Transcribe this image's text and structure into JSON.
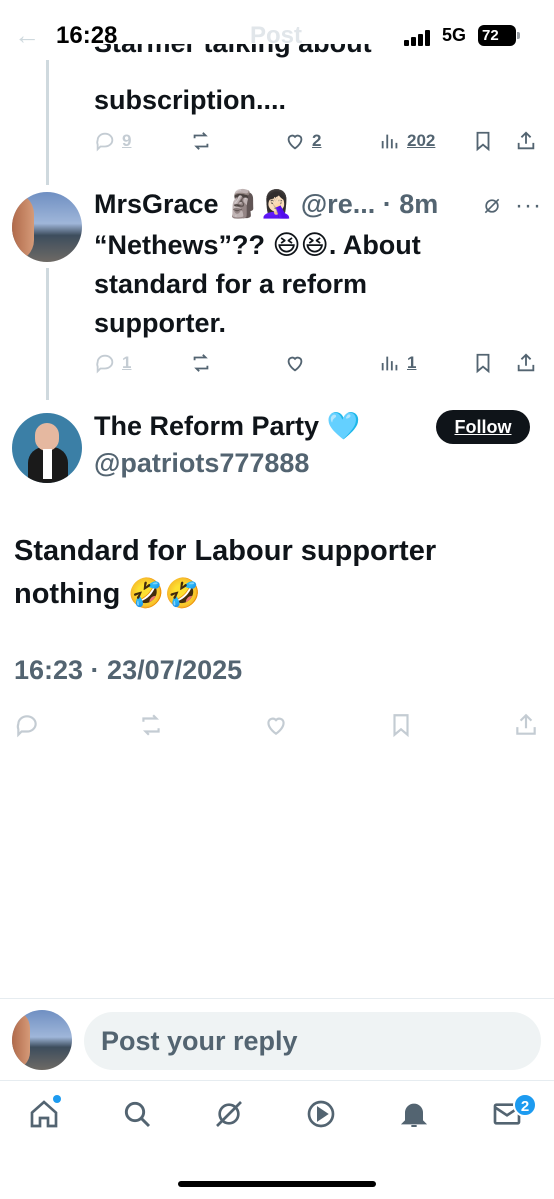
{
  "status_bar": {
    "time": "16:28",
    "network": "5G",
    "battery": "72",
    "header_title": "Post"
  },
  "thread": [
    {
      "text_clipped": "Starmer talking about",
      "text": "subscription....",
      "actions": {
        "replies": "9",
        "likes": "2",
        "views": "202"
      }
    },
    {
      "author_name": "MrsGrace",
      "author_emoji": "🗿🤦🏻‍♀️",
      "handle_time": "@re... · 8m",
      "text_lines": [
        "“Nethews”?? 😆😆. About",
        "standard for a reform",
        "supporter."
      ],
      "actions": {
        "replies": "1",
        "likes": "",
        "views": "1"
      }
    }
  ],
  "main_post": {
    "author_name": "The Reform Party",
    "author_emoji": "🩵",
    "handle": "@patriots777888",
    "follow_label": "Follow",
    "text_lines": [
      "Standard for  Labour supporter",
      "nothing 🤣🤣"
    ],
    "timestamp": "16:23 · 23/07/2025"
  },
  "reply": {
    "placeholder": "Post your reply"
  },
  "bottom_nav": {
    "items": [
      "home",
      "search",
      "grok",
      "video",
      "notifications",
      "messages"
    ],
    "messages_badge": "2"
  },
  "colors": {
    "text": "#0f1419",
    "secondary": "#536471",
    "accent": "#1d9bf0",
    "thread_line": "#cfd9de"
  }
}
